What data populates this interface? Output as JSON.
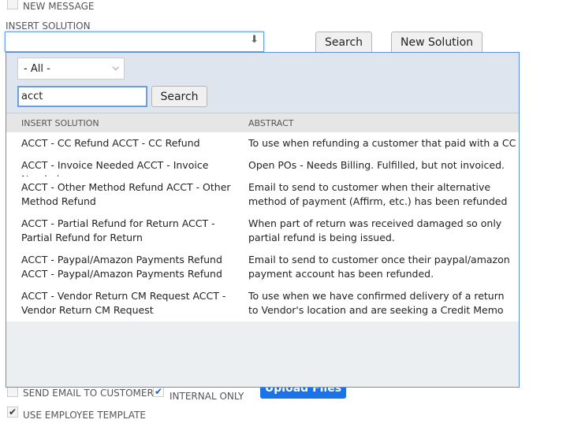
{
  "top": {
    "new_message_label": "NEW MESSAGE",
    "insert_solution_label": "INSERT SOLUTION",
    "insert_solution_value": "",
    "search_button": "Search",
    "new_solution_button": "New Solution"
  },
  "popup": {
    "filter_value": "- All -",
    "search_value": "acct",
    "search_button": "Search",
    "columns": [
      "INSERT SOLUTION",
      "ABSTRACT"
    ],
    "rows": [
      {
        "solution": "ACCT - CC Refund ACCT - CC Refund",
        "abstract": "To use when refunding a customer that paid with a CC"
      },
      {
        "solution": "ACCT - Invoice Needed ACCT - Invoice Needed",
        "abstract": "Open POs - Needs Billing. Fulfilled, but not invoiced."
      },
      {
        "solution": "ACCT - Other Method Refund ACCT - Other Method Refund",
        "abstract": "Email to send to customer when their alternative method of payment (Affirm, etc.) has been refunded"
      },
      {
        "solution": "ACCT - Partial Refund for Return ACCT - Partial Refund for Return",
        "abstract": "When part of return was received damaged so only partial refund is being issued."
      },
      {
        "solution": "ACCT - Paypal/Amazon Payments Refund ACCT - Paypal/Amazon Payments Refund",
        "abstract": "Email to send to customer once their paypal/amazon payment account has been refunded."
      },
      {
        "solution": "ACCT - Vendor Return CM Request ACCT - Vendor Return CM Request",
        "abstract": "To use when we have confirmed delivery of a return to Vendor's location and are seeking a Credit Memo"
      }
    ]
  },
  "bottom": {
    "send_email_label": "SEND EMAIL TO CUSTOMER",
    "send_email_checked": false,
    "internal_only_label": "INTERNAL ONLY",
    "internal_only_checked": true,
    "upload_button": "Upload Files",
    "use_template_label": "USE EMPLOYEE TEMPLATE",
    "use_template_checked": true
  },
  "colors": {
    "accent": "#5b8fd6",
    "upload_button": "#1a73e8"
  }
}
